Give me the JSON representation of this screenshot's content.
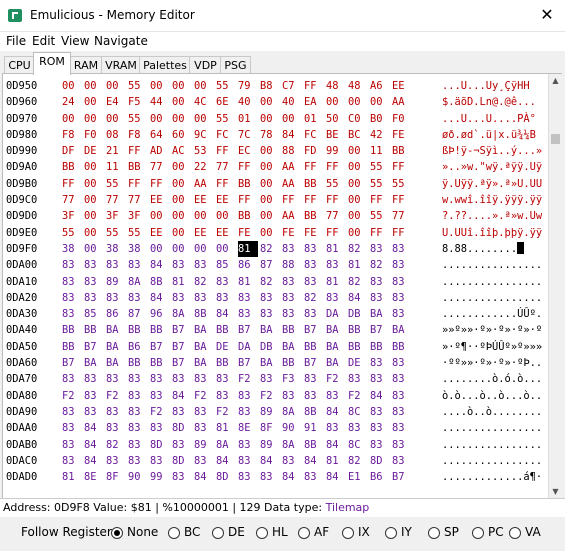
{
  "window": {
    "title": "Emulicious - Memory Editor"
  },
  "menu": [
    "File",
    "Edit",
    "View",
    "Navigate"
  ],
  "tabs": [
    "CPU",
    "ROM",
    "RAM",
    "VRAM",
    "Palettes",
    "VDP",
    "PSG"
  ],
  "active_tab": "ROM",
  "rows": [
    {
      "addr": "0D950",
      "bytes": [
        "00",
        "00",
        "00",
        "55",
        "00",
        "00",
        "00",
        "55",
        "79",
        "B8",
        "C7",
        "FF",
        "48",
        "48",
        "A6",
        "EE"
      ],
      "ascii": "...U...Uy¸ÇÿHH"
    },
    {
      "addr": "0D960",
      "bytes": [
        "24",
        "00",
        "E4",
        "F5",
        "44",
        "00",
        "4C",
        "6E",
        "40",
        "00",
        "40",
        "EA",
        "00",
        "00",
        "00",
        "AA"
      ],
      "ascii": "$.äõD.Ln@.@ê..."
    },
    {
      "addr": "0D970",
      "bytes": [
        "00",
        "00",
        "00",
        "55",
        "00",
        "00",
        "00",
        "55",
        "01",
        "00",
        "00",
        "01",
        "50",
        "C0",
        "B0",
        "F0"
      ],
      "ascii": "...U...U....PÀ°"
    },
    {
      "addr": "0D980",
      "bytes": [
        "F8",
        "F0",
        "08",
        "F8",
        "64",
        "60",
        "9C",
        "FC",
        "7C",
        "78",
        "84",
        "FC",
        "BE",
        "BC",
        "42",
        "FE"
      ],
      "ascii": "øð.ød`.ü|x.ü¾¼B"
    },
    {
      "addr": "0D990",
      "bytes": [
        "DF",
        "DE",
        "21",
        "FF",
        "AD",
        "AC",
        "53",
        "FF",
        "EC",
        "00",
        "88",
        "FD",
        "99",
        "00",
        "11",
        "BB"
      ],
      "ascii": "ßÞ!ÿ-¬Sÿì..ý...»"
    },
    {
      "addr": "0D9A0",
      "bytes": [
        "BB",
        "00",
        "11",
        "BB",
        "77",
        "00",
        "22",
        "77",
        "FF",
        "00",
        "AA",
        "FF",
        "FF",
        "00",
        "55",
        "FF"
      ],
      "ascii": "»..»w.\"wÿ.ªÿÿ.Uÿ"
    },
    {
      "addr": "0D9B0",
      "bytes": [
        "FF",
        "00",
        "55",
        "FF",
        "FF",
        "00",
        "AA",
        "FF",
        "BB",
        "00",
        "AA",
        "BB",
        "55",
        "00",
        "55",
        "55"
      ],
      "ascii": "ÿ.Uÿÿ.ªÿ».ª»U.UU"
    },
    {
      "addr": "0D9C0",
      "bytes": [
        "77",
        "00",
        "77",
        "77",
        "EE",
        "00",
        "EE",
        "EE",
        "FF",
        "00",
        "FF",
        "FF",
        "FF",
        "00",
        "FF",
        "FF"
      ],
      "ascii": "w.wwî.îîÿ.ÿÿÿ.ÿÿ"
    },
    {
      "addr": "0D9D0",
      "bytes": [
        "3F",
        "00",
        "3F",
        "3F",
        "00",
        "00",
        "00",
        "00",
        "BB",
        "00",
        "AA",
        "BB",
        "77",
        "00",
        "55",
        "77"
      ],
      "ascii": "?.??....».ª»w.Uw"
    },
    {
      "addr": "0D9E0",
      "bytes": [
        "55",
        "00",
        "55",
        "55",
        "EE",
        "00",
        "EE",
        "EE",
        "FE",
        "00",
        "FE",
        "FE",
        "FF",
        "00",
        "FF",
        "FF"
      ],
      "ascii": "U.UUî.îîþ.þþÿ.ÿÿ"
    },
    {
      "addr": "0D9F0",
      "bytes": [
        "38",
        "00",
        "38",
        "38",
        "00",
        "00",
        "00",
        "00",
        "81",
        "82",
        "83",
        "83",
        "81",
        "82",
        "83",
        "83"
      ],
      "ascii": "8.88........"
    },
    {
      "addr": "0DA00",
      "bytes": [
        "83",
        "83",
        "83",
        "83",
        "84",
        "83",
        "83",
        "85",
        "86",
        "87",
        "88",
        "83",
        "83",
        "81",
        "82",
        "83"
      ],
      "ascii": "................"
    },
    {
      "addr": "0DA10",
      "bytes": [
        "83",
        "83",
        "89",
        "8A",
        "8B",
        "81",
        "82",
        "83",
        "81",
        "82",
        "83",
        "83",
        "81",
        "82",
        "83",
        "83"
      ],
      "ascii": "................"
    },
    {
      "addr": "0DA20",
      "bytes": [
        "83",
        "83",
        "83",
        "83",
        "84",
        "83",
        "83",
        "83",
        "83",
        "83",
        "83",
        "82",
        "83",
        "84",
        "83",
        "83"
      ],
      "ascii": "................"
    },
    {
      "addr": "0DA30",
      "bytes": [
        "83",
        "85",
        "86",
        "87",
        "96",
        "8A",
        "8B",
        "84",
        "83",
        "83",
        "83",
        "83",
        "DA",
        "DB",
        "BA",
        "83"
      ],
      "ascii": "............ÚÛº."
    },
    {
      "addr": "0DA40",
      "bytes": [
        "BB",
        "BB",
        "BA",
        "BB",
        "BB",
        "B7",
        "BA",
        "BB",
        "B7",
        "BA",
        "BB",
        "B7",
        "BA",
        "BB",
        "B7",
        "BA"
      ],
      "ascii": "»»º»»·º»·º»·º»·º"
    },
    {
      "addr": "0DA50",
      "bytes": [
        "BB",
        "B7",
        "BA",
        "B6",
        "B7",
        "B7",
        "BA",
        "DE",
        "DA",
        "DB",
        "BA",
        "BB",
        "BA",
        "BB",
        "BB",
        "BB"
      ],
      "ascii": "»·º¶··ºÞÚÛº»º»»»"
    },
    {
      "addr": "0DA60",
      "bytes": [
        "B7",
        "BA",
        "BA",
        "BB",
        "BB",
        "B7",
        "BA",
        "BB",
        "B7",
        "BA",
        "BB",
        "B7",
        "BA",
        "DE",
        "83",
        "83"
      ],
      "ascii": "·ºº»»·º»·º»·ºÞ.."
    },
    {
      "addr": "0DA70",
      "bytes": [
        "83",
        "83",
        "83",
        "83",
        "83",
        "83",
        "83",
        "83",
        "F2",
        "83",
        "F3",
        "83",
        "F2",
        "83",
        "83",
        "83"
      ],
      "ascii": "........ò.ó.ò..."
    },
    {
      "addr": "0DA80",
      "bytes": [
        "F2",
        "83",
        "F2",
        "83",
        "83",
        "84",
        "F2",
        "83",
        "83",
        "F2",
        "83",
        "83",
        "83",
        "F2",
        "84",
        "83"
      ],
      "ascii": "ò.ò...ò..ò...ò.."
    },
    {
      "addr": "0DA90",
      "bytes": [
        "83",
        "83",
        "83",
        "83",
        "F2",
        "83",
        "83",
        "F2",
        "83",
        "89",
        "8A",
        "8B",
        "84",
        "8C",
        "83",
        "83"
      ],
      "ascii": "....ò..ò........"
    },
    {
      "addr": "0DAA0",
      "bytes": [
        "83",
        "84",
        "83",
        "83",
        "83",
        "8D",
        "83",
        "81",
        "8E",
        "8F",
        "90",
        "91",
        "83",
        "83",
        "83",
        "83"
      ],
      "ascii": "................"
    },
    {
      "addr": "0DAB0",
      "bytes": [
        "83",
        "84",
        "82",
        "83",
        "8D",
        "83",
        "89",
        "8A",
        "83",
        "89",
        "8A",
        "8B",
        "84",
        "8C",
        "83",
        "83"
      ],
      "ascii": "................"
    },
    {
      "addr": "0DAC0",
      "bytes": [
        "83",
        "84",
        "83",
        "83",
        "83",
        "8D",
        "83",
        "84",
        "83",
        "84",
        "83",
        "84",
        "81",
        "82",
        "8D",
        "83"
      ],
      "ascii": "................"
    },
    {
      "addr": "0DAD0",
      "bytes": [
        "81",
        "8E",
        "8F",
        "90",
        "99",
        "83",
        "84",
        "8D",
        "83",
        "83",
        "84",
        "83",
        "84",
        "E1",
        "B6",
        "B7"
      ],
      "ascii": ".............á¶·"
    }
  ],
  "purple_rows_from": 10,
  "selected": {
    "row": 10,
    "col": 8
  },
  "status": {
    "text": "Address: 0D9F8 Value: $81 | %10000001 | 129 Data type: ",
    "type": "Tilemap"
  },
  "follow": {
    "label": "Follow Register:",
    "options": [
      "None",
      "BC",
      "DE",
      "HL",
      "AF",
      "IX",
      "IY",
      "SP",
      "PC",
      "VA"
    ],
    "selected": "None"
  }
}
